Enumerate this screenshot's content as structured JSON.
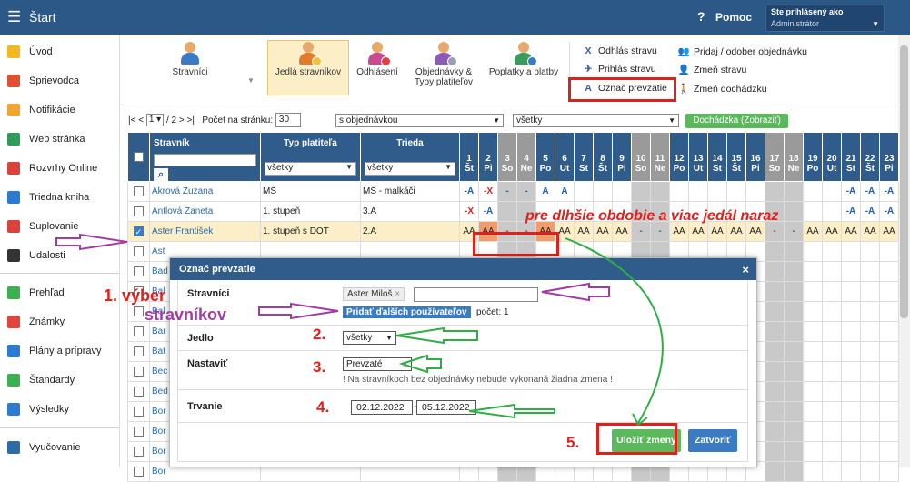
{
  "header": {
    "menu_glyph": "☰",
    "title": "Štart",
    "help_glyph": "?",
    "help_label": "Pomoc",
    "user_line1": "Ste prihlásený ako",
    "user_line2": "Administrátor"
  },
  "sidebar": [
    {
      "label": "Úvod",
      "icon": "star-icon",
      "color": "#f2b822"
    },
    {
      "label": "Sprievodca",
      "icon": "wand-icon",
      "color": "#e05033"
    },
    {
      "label": "Notifikácie",
      "icon": "envelope-icon",
      "color": "#f0a431"
    },
    {
      "label": "Web stránka",
      "icon": "home-icon",
      "color": "#2f9c5c"
    },
    {
      "label": "Rozvrhy Online",
      "icon": "calendar-icon",
      "color": "#d9433c"
    },
    {
      "label": "Triedna kniha",
      "icon": "book-icon",
      "color": "#2d7bd0"
    },
    {
      "label": "Suplovanie",
      "icon": "substitute-icon",
      "color": "#d9433c"
    },
    {
      "label": "Udalosti",
      "icon": "events-icon",
      "color": "#333"
    },
    {
      "label": "Prehľad",
      "icon": "check-icon",
      "color": "#3ab050"
    },
    {
      "label": "Známky",
      "icon": "grades-icon",
      "color": "#e0453c"
    },
    {
      "label": "Plány a prípravy",
      "icon": "briefcase-icon",
      "color": "#2d7bd0"
    },
    {
      "label": "Štandardy",
      "icon": "shield-icon",
      "color": "#3ab050"
    },
    {
      "label": "Výsledky",
      "icon": "chart-icon",
      "color": "#2d7bd0"
    },
    {
      "label": "Vyučovanie",
      "icon": "classroom-icon",
      "color": "#2d6aa8"
    }
  ],
  "toolbar": {
    "buttons": [
      "Stravníci",
      "Jedlá stravníkov",
      "Odhlásení",
      "Objednávky &",
      "Typy platiteľov",
      "Poplatky a platby"
    ],
    "actions": [
      {
        "glyph": "X",
        "label": "Odhlás stravu"
      },
      {
        "glyph": "✈",
        "label": "Prihlás stravu"
      },
      {
        "glyph": "A",
        "label": "Označ prevzatie"
      },
      {
        "glyph": "👥",
        "label": "Pridaj / odober objednávku"
      },
      {
        "glyph": "👤",
        "label": "Zmeň stravu"
      },
      {
        "glyph": "🚶",
        "label": "Zmeň dochádzku"
      }
    ]
  },
  "pager": {
    "first": "|<",
    "prev": "<",
    "page": "1",
    "of": "/ 2",
    "next": ">",
    "last": ">|",
    "per_page_label": "Počet na stránku:",
    "per_page": "30",
    "filter1": "s objednávkou",
    "filter2": "všetky",
    "attendance_btn": "Dochádzka (Zobraziť)"
  },
  "table": {
    "headers": {
      "stravnik": "Stravník",
      "typ": "Typ platiteľa",
      "trieda": "Trieda"
    },
    "filter_typ": "všetky",
    "filter_trieda": "všetky",
    "days": [
      {
        "n": "1",
        "d": "Št",
        "wk": false
      },
      {
        "n": "2",
        "d": "Pi",
        "wk": false
      },
      {
        "n": "3",
        "d": "So",
        "wk": true
      },
      {
        "n": "4",
        "d": "Ne",
        "wk": true
      },
      {
        "n": "5",
        "d": "Po",
        "wk": false
      },
      {
        "n": "6",
        "d": "Ut",
        "wk": false
      },
      {
        "n": "7",
        "d": "St",
        "wk": false
      },
      {
        "n": "8",
        "d": "Št",
        "wk": false
      },
      {
        "n": "9",
        "d": "Pi",
        "wk": false
      },
      {
        "n": "10",
        "d": "So",
        "wk": true
      },
      {
        "n": "11",
        "d": "Ne",
        "wk": true
      },
      {
        "n": "12",
        "d": "Po",
        "wk": false
      },
      {
        "n": "13",
        "d": "Ut",
        "wk": false
      },
      {
        "n": "14",
        "d": "St",
        "wk": false
      },
      {
        "n": "15",
        "d": "Št",
        "wk": false
      },
      {
        "n": "16",
        "d": "Pi",
        "wk": false
      },
      {
        "n": "17",
        "d": "So",
        "wk": true
      },
      {
        "n": "18",
        "d": "Ne",
        "wk": true
      },
      {
        "n": "19",
        "d": "Po",
        "wk": false
      },
      {
        "n": "20",
        "d": "Ut",
        "wk": false
      },
      {
        "n": "21",
        "d": "St",
        "wk": false
      },
      {
        "n": "22",
        "d": "Št",
        "wk": false
      },
      {
        "n": "23",
        "d": "Pi",
        "wk": false
      }
    ],
    "rows": [
      {
        "checked": false,
        "name": "Akrová Zuzana",
        "typ": "MŠ",
        "trieda": "MŠ - malkáči",
        "cells": [
          "-A",
          "-X",
          "-",
          "-",
          "A",
          "A",
          "",
          "",
          "",
          "",
          "",
          "",
          "",
          "",
          "",
          "",
          "",
          "",
          "",
          "",
          "-A",
          "-A",
          "-A"
        ]
      },
      {
        "checked": false,
        "name": "Antlová Žaneta",
        "typ": "1. stupeň",
        "trieda": "3.A",
        "cells": [
          "-X",
          "-A",
          "",
          "",
          "",
          "",
          "",
          "",
          "",
          "",
          "",
          "",
          "",
          "",
          "",
          "",
          "",
          "",
          "",
          "",
          "-A",
          "-A",
          "-A"
        ]
      },
      {
        "checked": true,
        "name": "Aster František",
        "typ": "1. stupeň s DOT",
        "trieda": "2.A",
        "cells": [
          "AA",
          "AA",
          "-",
          "-",
          "AA",
          "AA",
          "AA",
          "AA",
          "AA",
          "-",
          "-",
          "AA",
          "AA",
          "AA",
          "AA",
          "AA",
          "-",
          "-",
          "AA",
          "AA",
          "AA",
          "AA",
          "AA"
        ]
      },
      {
        "checked": false,
        "name": "Ast",
        "typ": "",
        "trieda": "",
        "cells": []
      },
      {
        "checked": false,
        "name": "Bad",
        "typ": "",
        "trieda": "",
        "cells": []
      },
      {
        "checked": false,
        "name": "Bal",
        "typ": "",
        "trieda": "",
        "cells": []
      },
      {
        "checked": false,
        "name": "Bal",
        "typ": "",
        "trieda": "",
        "cells": []
      },
      {
        "checked": false,
        "name": "Bar",
        "typ": "",
        "trieda": "",
        "cells": []
      },
      {
        "checked": false,
        "name": "Bat",
        "typ": "",
        "trieda": "",
        "cells": []
      },
      {
        "checked": false,
        "name": "Bec",
        "typ": "",
        "trieda": "",
        "cells": []
      },
      {
        "checked": false,
        "name": "Bed",
        "typ": "",
        "trieda": "",
        "cells": []
      },
      {
        "checked": false,
        "name": "Bor",
        "typ": "",
        "trieda": "",
        "cells": []
      },
      {
        "checked": false,
        "name": "Bor",
        "typ": "",
        "trieda": "",
        "cells": []
      },
      {
        "checked": false,
        "name": "Bor",
        "typ": "",
        "trieda": "",
        "cells": []
      },
      {
        "checked": false,
        "name": "Bor",
        "typ": "",
        "trieda": "",
        "cells": []
      }
    ]
  },
  "modal": {
    "title": "Označ prevzatie",
    "close": "×",
    "stravnici_label": "Stravníci",
    "tag": "Aster Miloš",
    "tag_x": "×",
    "add_users": "Pridať ďalších používateľov",
    "count": "počet: 1",
    "jedlo_label": "Jedlo",
    "jedlo_value": "všetky",
    "nastavit_label": "Nastaviť",
    "nastavit_value": "Prevzaté",
    "note": "! Na stravníkoch bez objednávky nebude vykonaná žiadna zmena !",
    "trvanie_label": "Trvanie",
    "date_from": "02.12.2022",
    "date_to": "05.12.2022",
    "dash": "-",
    "save": "Uložiť zmeny",
    "close_btn": "Zatvoriť"
  },
  "annotations": {
    "step1a": "1. výber",
    "step1b": "stravníkov",
    "step2": "2.",
    "step3": "3.",
    "step4": "4.",
    "step5": "5.",
    "banner": "pre dlhšie obdobie a viac jedál naraz"
  },
  "colors": {
    "header": "#2b5887",
    "table_header": "#2f5c8a",
    "highlight": "#fcefc7",
    "accent_red": "#e0201b",
    "annotation_purple": "#a23ca2",
    "green_button": "#5cb85c"
  }
}
